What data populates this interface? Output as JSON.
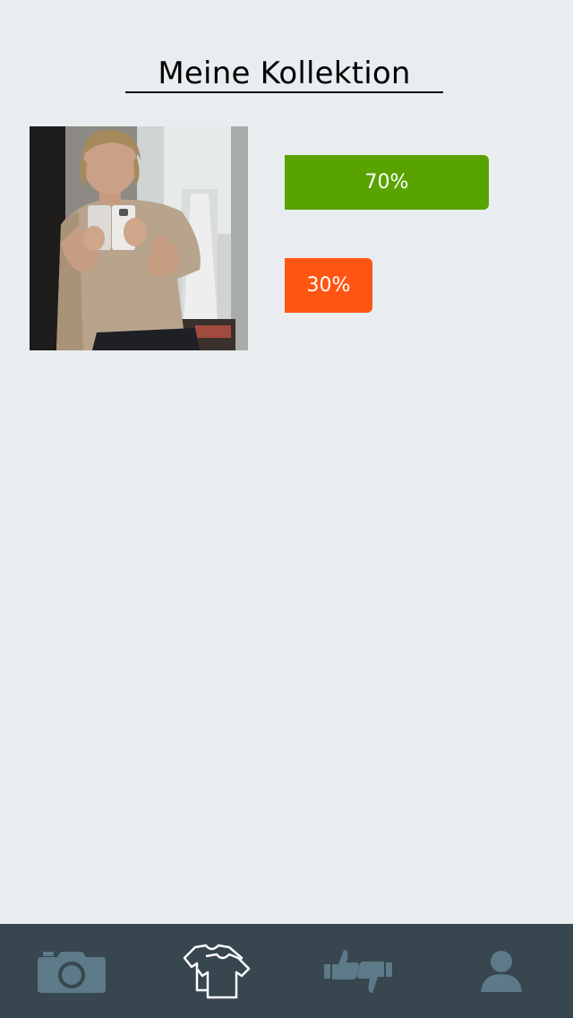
{
  "header": {
    "title": "Meine Kollektion"
  },
  "collection_item": {
    "image_alt": "outfit photo",
    "votes": [
      {
        "label": "70%",
        "percent": 70,
        "color": "#58a300",
        "type": "like"
      },
      {
        "label": "30%",
        "percent": 30,
        "color": "#ff5512",
        "type": "dislike"
      }
    ]
  },
  "tabbar": {
    "background": "#37464f",
    "active_color": "#ffffff",
    "inactive_color": "#5c7a87",
    "tabs": [
      {
        "icon": "camera-icon",
        "active": false
      },
      {
        "icon": "clothes-icon",
        "active": true
      },
      {
        "icon": "thumbs-up-down-icon",
        "active": false
      },
      {
        "icon": "profile-icon",
        "active": false
      }
    ]
  }
}
